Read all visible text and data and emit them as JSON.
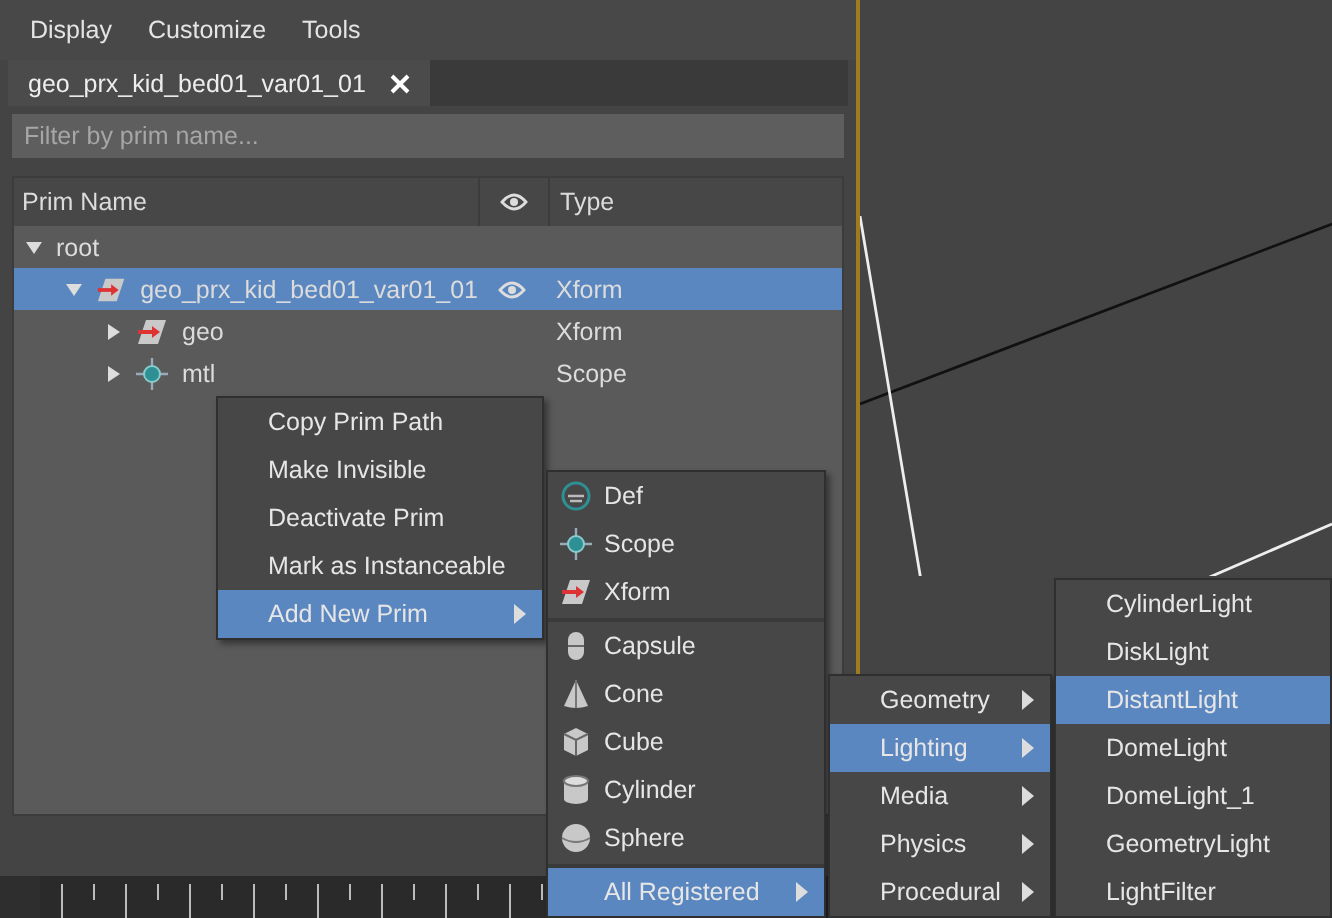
{
  "menubar": [
    "Display",
    "Customize",
    "Tools"
  ],
  "tabs": [
    {
      "label": "geo_prx_kid_bed01_var01_01",
      "selected": true
    }
  ],
  "filter": {
    "placeholder": "Filter by prim name..."
  },
  "columns": [
    "Prim Name",
    "Type"
  ],
  "tree": [
    {
      "name": "root",
      "selected": false,
      "expanded": true,
      "children": [
        {
          "name": "geo_prx_kid_bed01_var01_01",
          "kind": "xform",
          "type": "Xform",
          "selected": true,
          "expanded": true,
          "children": [
            {
              "name": "geo",
              "kind": "xform",
              "type": "Xform",
              "selected": false,
              "expanded": false
            },
            {
              "name": "mtl",
              "kind": "scope",
              "type": "Scope",
              "selected": false,
              "expanded": false
            }
          ]
        }
      ]
    }
  ],
  "context_menu": [
    {
      "label": "Copy Prim Path",
      "selected": false,
      "submenu": false
    },
    {
      "label": "Make Invisible",
      "selected": false,
      "submenu": false
    },
    {
      "label": "Deactivate Prim",
      "selected": false,
      "submenu": false
    },
    {
      "label": "Mark as Instanceable",
      "selected": false,
      "submenu": false
    },
    {
      "label": "Add New Prim",
      "selected": true,
      "submenu": true
    }
  ],
  "prim_menu": [
    {
      "label": "Def",
      "kind": "def",
      "selected": false,
      "submenu": false,
      "separator_before": false
    },
    {
      "label": "Scope",
      "kind": "scope",
      "selected": false,
      "submenu": false,
      "separator_before": false
    },
    {
      "label": "Xform",
      "kind": "xform",
      "selected": false,
      "submenu": false,
      "separator_before": false
    },
    {
      "label": "Capsule",
      "kind": "capsule",
      "selected": false,
      "submenu": false,
      "separator_before": true
    },
    {
      "label": "Cone",
      "kind": "cone",
      "selected": false,
      "submenu": false,
      "separator_before": false
    },
    {
      "label": "Cube",
      "kind": "cube",
      "selected": false,
      "submenu": false,
      "separator_before": false
    },
    {
      "label": "Cylinder",
      "kind": "cylinder",
      "selected": false,
      "submenu": false,
      "separator_before": false
    },
    {
      "label": "Sphere",
      "kind": "sphere",
      "selected": false,
      "submenu": false,
      "separator_before": false
    },
    {
      "label": "All Registered",
      "kind": "none",
      "selected": true,
      "submenu": true,
      "separator_before": true
    }
  ],
  "category_menu": [
    {
      "label": "Geometry",
      "selected": false,
      "submenu": true
    },
    {
      "label": "Lighting",
      "selected": true,
      "submenu": true
    },
    {
      "label": "Media",
      "selected": false,
      "submenu": true
    },
    {
      "label": "Physics",
      "selected": false,
      "submenu": true
    },
    {
      "label": "Procedural",
      "selected": false,
      "submenu": true
    }
  ],
  "light_menu": [
    {
      "label": "CylinderLight",
      "selected": false,
      "submenu": false
    },
    {
      "label": "DiskLight",
      "selected": false,
      "submenu": false
    },
    {
      "label": "DistantLight",
      "selected": true,
      "submenu": false
    },
    {
      "label": "DomeLight",
      "selected": false,
      "submenu": false
    },
    {
      "label": "DomeLight_1",
      "selected": false,
      "submenu": false
    },
    {
      "label": "GeometryLight",
      "selected": false,
      "submenu": false
    },
    {
      "label": "LightFilter",
      "selected": false,
      "submenu": false
    }
  ]
}
